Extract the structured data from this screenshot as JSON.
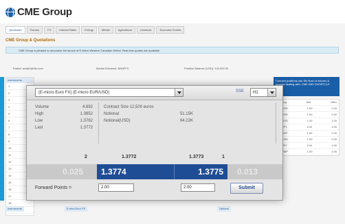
{
  "header": {
    "logo_text": "CME Group"
  },
  "nav": {
    "tabs": [
      "Quotestart",
      "Futures",
      "FX",
      "Interest Rates",
      "Energy",
      "Metals",
      "Agricultural",
      "Livestock",
      "Economic Events"
    ]
  },
  "page": {
    "section_title": "CME Group & Quotations",
    "notice": "CME Group is pleased to announce the launch of E-Micro Western Canadian Select. Real-time quotes are available.",
    "info": [
      "Traded: andyfx@hfn.com",
      "Market Entrance: BANFFX",
      "Position Balance (USD): 100,000.00"
    ]
  },
  "left_panel": {
    "header": "Instruments",
    "rows": [
      "1",
      "2",
      "3",
      "4",
      "5",
      "6",
      "7",
      "8",
      "9",
      "10",
      "11",
      "12",
      "13",
      "14",
      "15",
      "16",
      "17",
      "18",
      "19"
    ]
  },
  "right_panel": {
    "promo": "Connect positions into Sfx Now on futures & forward dealing with: CME EBS SHORTCUT",
    "rows": [
      [
        "Net Chg",
        "Bid",
        "Offer"
      ],
      [
        "EURUSD",
        "1.00",
        "1.00"
      ],
      [
        "GBPUSD",
        "1.00",
        "1.00"
      ],
      [
        "AUDUSD",
        "1.00",
        "1.00"
      ],
      [
        "USDJPY",
        "1.00",
        "1.00"
      ],
      [
        "USDCHF",
        "1.00",
        "1.00"
      ],
      [
        "USDCAD",
        "1.00",
        "1.00"
      ],
      [
        "EURJPY",
        "1.00",
        "1.00"
      ],
      [
        "EURGBP",
        "1.00",
        "1.00"
      ]
    ]
  },
  "bottom": {
    "tabs": [
      "Instruments",
      "E-mini Euro FX",
      "Options"
    ]
  },
  "modal": {
    "contract_select": "(E-micro Euro FX) (E-micro EUR/USD)",
    "sse_label": "SSE",
    "month_select": "H1",
    "stats_left": [
      {
        "label": "Volume",
        "value": "4,692"
      },
      {
        "label": "High",
        "value": "1.3852"
      },
      {
        "label": "Low",
        "value": "1.3762"
      },
      {
        "label": "Last",
        "value": "1.3772"
      }
    ],
    "stats_right": [
      {
        "label": "Contract Size 12,500 euros",
        "value": ""
      },
      {
        "label": "Notional",
        "value": "51.15K"
      },
      {
        "label": "Notional(USD)",
        "value": "64.22K"
      }
    ],
    "bid_qty": "2",
    "bid_price_small": "1.3772",
    "ask_price_small": "1.3773",
    "ask_qty": "1",
    "ghost_bid": "0.025",
    "bid": "1.3774",
    "ask": "1.3775",
    "ghost_ask": "0.013",
    "forward_points_label": "Forward Points =",
    "forward_points_value": "2.00",
    "forward_points_right": "2.00",
    "submit_label": "Submit"
  }
}
